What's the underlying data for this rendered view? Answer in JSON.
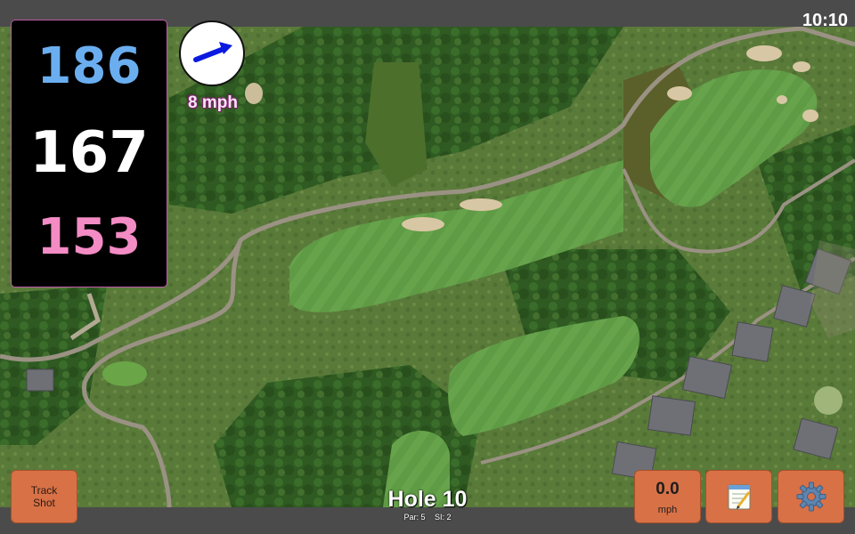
{
  "status": {
    "time": "10:10"
  },
  "distances": {
    "back": "186",
    "middle": "167",
    "front": "153"
  },
  "wind": {
    "speed_label": "8 mph",
    "direction_icon": "arrow-icon"
  },
  "hole": {
    "title": "Hole 10",
    "par": "Par: 5",
    "stroke_index": "SI: 2"
  },
  "buttons": {
    "track_shot": {
      "line1": "Track",
      "line2": "Shot"
    },
    "speed": {
      "value": "0.0",
      "unit": "mph"
    },
    "notes": {
      "icon": "notepad-icon"
    },
    "settings": {
      "icon": "gear-icon"
    }
  },
  "colors": {
    "back_distance": "#6aaef0",
    "middle_distance": "#ffffff",
    "front_distance": "#f38bc4",
    "button_bg": "#d87146",
    "bar_bg": "#4b4b4b"
  }
}
